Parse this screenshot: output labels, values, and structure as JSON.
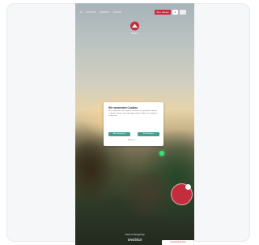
{
  "header": {
    "nav_items": [
      "A · Lorem",
      "Ipsum",
      "Dolor"
    ],
    "lang_label": "Tour planen",
    "search_icon": "search-icon",
    "menu_icon": "menu-icon"
  },
  "logo": {
    "text": "Tourism"
  },
  "cookie_banner": {
    "title": "Wir verwenden Cookies",
    "body": "Diese Website nutzt Cookies, um Ihnen ein optimales Erlebnis zu bieten. Einige sind notwendig, andere helfen uns, Inhalte zu verbessern.",
    "accept_label": "Alle akzeptieren",
    "settings_label": "Einstellungen",
    "link_label": "Ablehnen"
  },
  "footer": {
    "subtitle": "Urlaub im Mittelgebirge",
    "title": "Weitblick",
    "cta_label": "Unterkunft buchen"
  },
  "colors": {
    "brand": "#c42d3c",
    "button": "#4d9b8f"
  }
}
